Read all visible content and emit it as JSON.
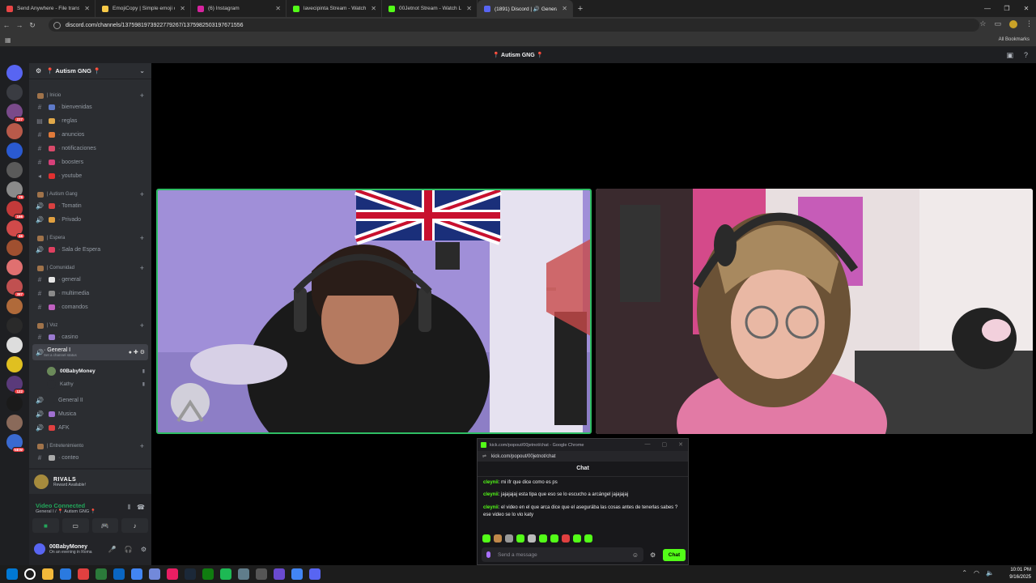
{
  "browser": {
    "tabs": [
      {
        "title": "Send Anywhere - File transfer",
        "color": "#e84545"
      },
      {
        "title": "EmojiCopy | Simple emoji copy",
        "color": "#f7c948"
      },
      {
        "title": "(6) Instagram",
        "color": "#d6249f"
      },
      {
        "title": "lavecipinta Stream - Watch Live",
        "color": "#53fc18"
      },
      {
        "title": "00Jetnot Stream - Watch Live o",
        "color": "#53fc18"
      },
      {
        "title": "(1891) Discord | 🔊 General",
        "color": "#5865f2"
      }
    ],
    "url": "discord.com/channels/1375981973922779267/1375982503197671556",
    "all_bookmarks": "All Bookmarks"
  },
  "discord": {
    "stage_title": "📍 Autism GNG 📍",
    "guild_name": "📍 Autism GNG 📍",
    "rows": [
      {
        "type": "cat",
        "label": "| Inicio"
      },
      {
        "type": "ch",
        "icon": "#",
        "label": "· bienvenidas",
        "emoji": "#5e7ac9"
      },
      {
        "type": "ch",
        "icon": "▤",
        "label": "· reglas",
        "emoji": "#e0a84a"
      },
      {
        "type": "ch",
        "icon": "#",
        "label": "· anuncios",
        "emoji": "#e07a3a"
      },
      {
        "type": "ch",
        "icon": "#",
        "label": "· notificaciones",
        "emoji": "#d94a6a"
      },
      {
        "type": "ch",
        "icon": "#",
        "label": "· boosters",
        "emoji": "#d6407a"
      },
      {
        "type": "ch",
        "icon": "◂",
        "label": "· youtube",
        "emoji": "#e03030"
      },
      {
        "type": "cat",
        "label": "| Autism Gang"
      },
      {
        "type": "ch",
        "icon": "🔊",
        "label": "· Tomatin",
        "emoji": "#d94040"
      },
      {
        "type": "ch",
        "icon": "🔊",
        "label": "· Privado",
        "emoji": "#e0a040"
      },
      {
        "type": "cat",
        "label": "| Espera"
      },
      {
        "type": "ch",
        "icon": "🔊",
        "label": "· Sala de Espera",
        "emoji": "#e04060"
      },
      {
        "type": "cat",
        "label": "| Comunidad"
      },
      {
        "type": "ch",
        "icon": "#",
        "label": "· general",
        "emoji": "#e6e6e6"
      },
      {
        "type": "ch",
        "icon": "#",
        "label": "· multimedia",
        "emoji": "#8a8a8a"
      },
      {
        "type": "ch",
        "icon": "#",
        "label": "· comandos",
        "emoji": "#c060c0"
      },
      {
        "type": "cat",
        "label": "| Voz"
      },
      {
        "type": "ch",
        "icon": "#",
        "label": "· casino",
        "emoji": "#9a7ad0"
      }
    ],
    "voice_channel": {
      "label": "· General I",
      "status": "Set a channel status"
    },
    "members": [
      {
        "name": "00BabyMoney",
        "color": "#f2f3f5",
        "avatar": "#6b8a5a"
      },
      {
        "name": "Kathy",
        "color": "#949ba4",
        "avatar": "#2b2d31"
      }
    ],
    "rows2": [
      {
        "type": "ch",
        "icon": "🔊",
        "label": "General II",
        "emoji": "#2b2d31"
      },
      {
        "type": "ch",
        "icon": "🔊",
        "label": "Musica",
        "emoji": "#a070d0"
      },
      {
        "type": "ch",
        "icon": "🔊",
        "label": "AFK",
        "emoji": "#e04040"
      },
      {
        "type": "cat",
        "label": "| Entretenimiento"
      },
      {
        "type": "ch",
        "icon": "#",
        "label": "· conteo",
        "emoji": "#aaaaaa"
      }
    ],
    "rivals": {
      "title": "RIVALS",
      "sub": "Reward Available!"
    },
    "voice_status": {
      "title": "Video Connected",
      "sub": "General I / 📍 Autism GNG 📍"
    },
    "user": {
      "name": "00BabyMoney",
      "status": "On an evening in Roma"
    },
    "servers": [
      {
        "c": "#5865f2"
      },
      {
        "c": "#3a3c42"
      },
      {
        "c": "#7a4a8a",
        "b": "227"
      },
      {
        "c": "#b85a4a"
      },
      {
        "c": "#2a5ad0"
      },
      {
        "c": "#5a5a5a"
      },
      {
        "c": "#8a8a8a",
        "b": "78"
      },
      {
        "c": "#c23a3a",
        "b": "166"
      },
      {
        "c": "#d04a4a",
        "b": "46"
      },
      {
        "c": "#a05030"
      },
      {
        "c": "#e07070"
      },
      {
        "c": "#c05050",
        "b": "387"
      },
      {
        "c": "#b06a3a"
      },
      {
        "c": "#2a2a2a"
      },
      {
        "c": "#ddd"
      },
      {
        "c": "#e0c020"
      },
      {
        "c": "#5a3a7a",
        "b": "122"
      },
      {
        "c": "#1a1a1a"
      },
      {
        "c": "#8a6a5a"
      },
      {
        "c": "#3a6ad0",
        "b": "NEW"
      }
    ]
  },
  "kick_popup": {
    "window_title": "kick.com/popout/00jetnot/chat - Google Chrome",
    "url": "kick.com/popout/00jetnot/chat",
    "header": "Chat",
    "messages": [
      {
        "user": "cleynii",
        "text": ": mi ifr que dice como es ps"
      },
      {
        "user": "cleynii",
        "text": ": jajajajaj esta tipa que eso se lo escucho a arcángel jajajajaj"
      },
      {
        "user": "cleynii",
        "text": ": el video en el que arca dice que el asegurába las cosas antes de tenerlas sabes ? ese video se lo vio katy"
      }
    ],
    "placeholder": "Send a message",
    "send_label": "Chat"
  },
  "taskbar": {
    "time": "10:01 PM",
    "date": "9/16/2025",
    "apps": [
      "#0078d4",
      "#ffffff",
      "#f2b83a",
      "#2a7ae0",
      "#e04040",
      "#2b7a3a",
      "#0a66c2",
      "#4285f4",
      "#7289da",
      "#e91e63",
      "#1b2838",
      "#107c10",
      "#1db954",
      "#607d8b",
      "#555555",
      "#6a4ad0",
      "#4285f4",
      "#5865f2"
    ]
  }
}
